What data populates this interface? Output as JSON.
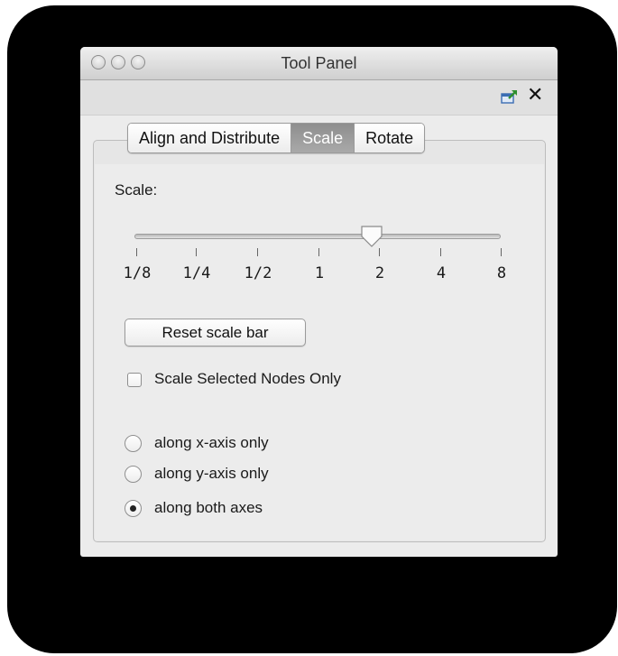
{
  "window": {
    "title": "Tool Panel"
  },
  "toolbar": {
    "undock_icon": "undock-icon",
    "close_icon": "close-icon",
    "close_glyph": "✕"
  },
  "tabs": [
    {
      "label": "Align and Distribute",
      "active": false
    },
    {
      "label": "Scale",
      "active": true
    },
    {
      "label": "Rotate",
      "active": false
    }
  ],
  "scale": {
    "label": "Scale:",
    "slider_ticks": [
      "1/8",
      "1/4",
      "1/2",
      "1",
      "2",
      "4",
      "8"
    ],
    "slider_value": "2",
    "reset_button_label": "Reset scale bar",
    "selected_only_label": "Scale Selected Nodes Only",
    "selected_only_checked": false
  },
  "axis_options": [
    {
      "label": "along x-axis only",
      "checked": false
    },
    {
      "label": "along y-axis only",
      "checked": false
    },
    {
      "label": "along both axes",
      "checked": true
    }
  ],
  "colors": {
    "active_tab": "#9a9a9a",
    "window_bg": "#ececec",
    "frame": "#000000"
  }
}
